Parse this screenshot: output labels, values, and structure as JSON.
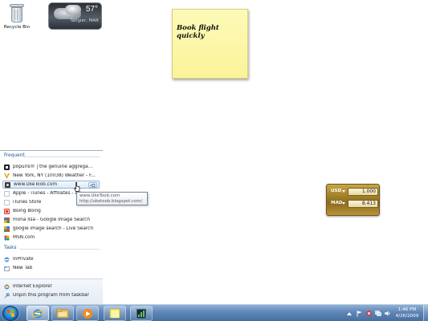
{
  "desktop": {
    "recycle_bin_label": "Recycle Bin",
    "weather": {
      "temperature": "57°",
      "location": "Tangier, MAR"
    },
    "sticky_note": {
      "text": "Book flight quickly"
    },
    "currency": {
      "rows": [
        {
          "code": "USD",
          "value": "1.000"
        },
        {
          "code": "MAD",
          "value": "8.413"
        }
      ]
    }
  },
  "jumplist": {
    "frequent_heading": "Frequent",
    "frequent_items": [
      {
        "label": "popurls® | the genuine aggrega...",
        "icon": "popurls-favicon",
        "color": "#222222"
      },
      {
        "label": "New York, NY (10038) Weather - F...",
        "icon": "weather-favicon",
        "color": "#e8a317"
      },
      {
        "label": "www.UkeToob.com",
        "icon": "uketoob-favicon",
        "color": "#3b3b3b"
      },
      {
        "label": "Apple - iTunes - Affiliates - Do...",
        "icon": "apple-page-icon",
        "color": "#b9c4cf"
      },
      {
        "label": "iTunes Store",
        "icon": "itunes-page-icon",
        "color": "#b9c4cf"
      },
      {
        "label": "Boing Boing",
        "icon": "boingboing-favicon",
        "color": "#d83b2b"
      },
      {
        "label": "mona lisa - Google Image Search",
        "icon": "google-favicon",
        "color": "#3a7be0"
      },
      {
        "label": "google image search - Live Search",
        "icon": "live-search-favicon",
        "color": "#f0a21b"
      },
      {
        "label": "MSN.com",
        "icon": "msn-favicon",
        "color": "#2b8be0"
      }
    ],
    "tasks_heading": "Tasks",
    "task_items": [
      {
        "label": "InPrivate",
        "icon": "inprivate-icon"
      },
      {
        "label": "New Tab",
        "icon": "new-tab-icon"
      }
    ],
    "bottom_items": [
      {
        "label": "Internet Explorer",
        "icon": "internet-explorer-icon"
      },
      {
        "label": "Unpin this program from taskbar",
        "icon": "unpin-icon"
      }
    ],
    "tooltip": {
      "line1": "www.UkeToob.com",
      "line2": "http://uketoob.blogspot.com/"
    }
  },
  "taskbar": {
    "clock_time": "1:46 PM",
    "clock_date": "4/26/2009"
  },
  "colors": {
    "jumplist_heading": "#1e4f91",
    "taskbar_blue": "#5e86b6",
    "sticky_yellow": "#faf39a",
    "currency_gold": "#b89338"
  }
}
